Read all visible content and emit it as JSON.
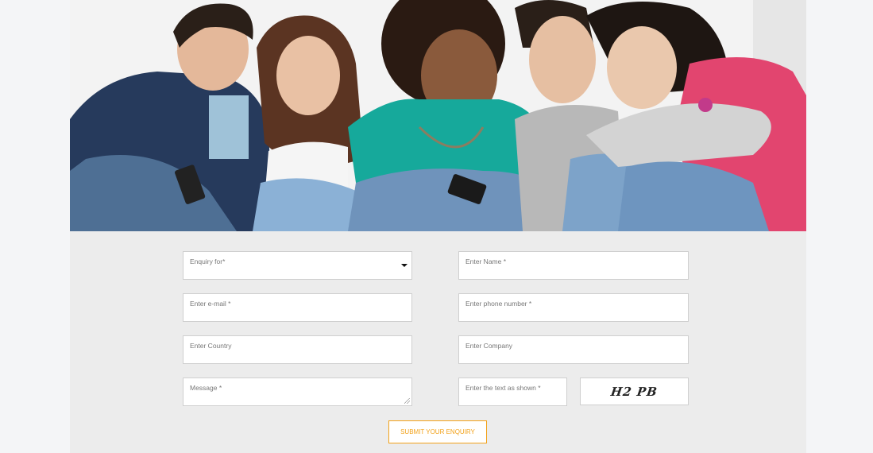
{
  "form": {
    "enquiry_for": {
      "placeholder": "Enquiry for*"
    },
    "name": {
      "placeholder": "Enter Name *"
    },
    "email": {
      "placeholder": "Enter e-mail *"
    },
    "phone": {
      "placeholder": "Enter phone number *"
    },
    "country": {
      "placeholder": "Enter Country"
    },
    "company": {
      "placeholder": "Enter Company"
    },
    "message": {
      "placeholder": "Message *"
    },
    "captcha_input": {
      "placeholder": "Enter the text as shown *"
    },
    "captcha_text": "H2 PB",
    "submit_label": "SUBMIT YOUR ENQUIRY"
  },
  "colors": {
    "accent": "#f2a21a",
    "form_background": "#ececec",
    "page_background": "#f4f5f7"
  }
}
